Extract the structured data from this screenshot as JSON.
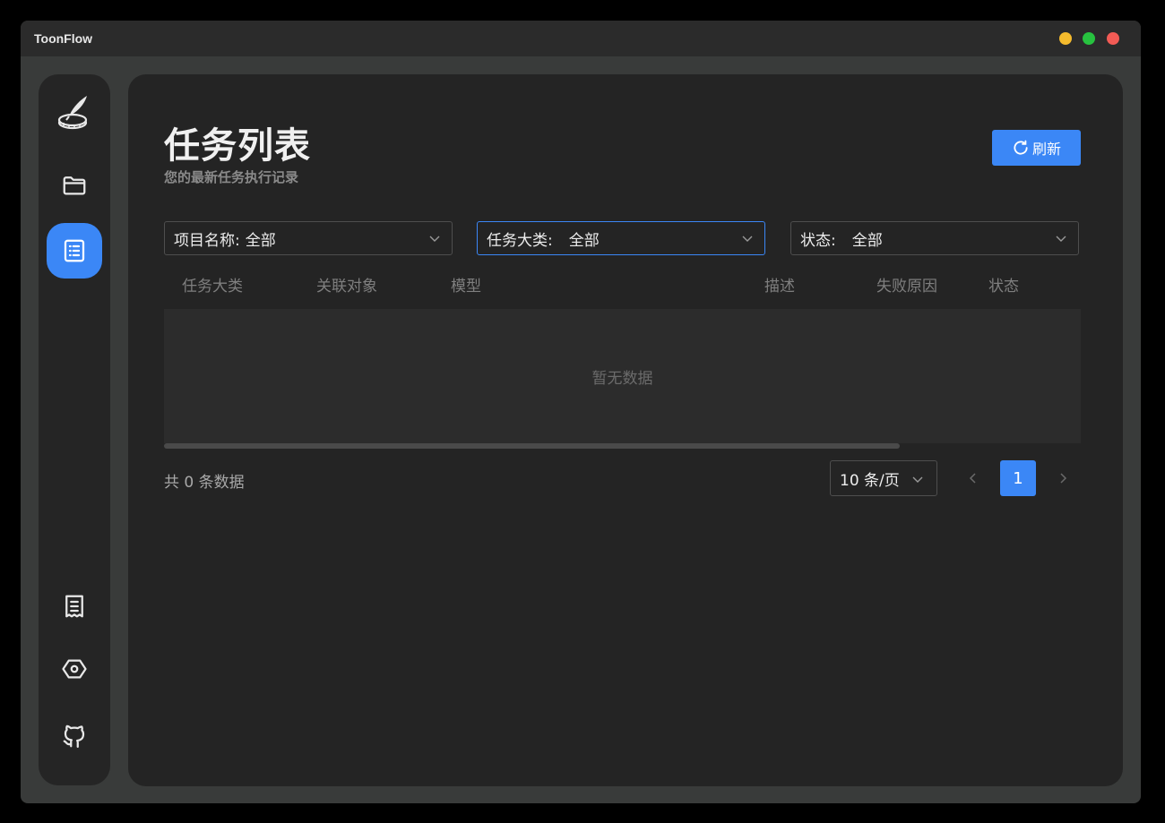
{
  "window": {
    "title": "ToonFlow"
  },
  "sidebar": {
    "items": [
      {
        "name": "pen-logo-icon",
        "active": false
      },
      {
        "name": "folder-icon",
        "active": false
      },
      {
        "name": "task-list-icon",
        "active": true
      },
      {
        "name": "receipt-icon",
        "active": false
      },
      {
        "name": "settings-hexagon-icon",
        "active": false
      },
      {
        "name": "github-icon",
        "active": false
      }
    ]
  },
  "header": {
    "title": "任务列表",
    "subtitle": "您的最新任务执行记录",
    "refresh_label": "刷新"
  },
  "filters": [
    {
      "label": "项目名称:",
      "value": "全部"
    },
    {
      "label": "任务大类:",
      "value": "全部"
    },
    {
      "label": "状态:",
      "value": "全部"
    }
  ],
  "table": {
    "columns": [
      "任务大类",
      "关联对象",
      "模型",
      "描述",
      "失败原因",
      "状态"
    ],
    "empty_text": "暂无数据"
  },
  "pagination": {
    "total_text": "共 0 条数据",
    "page_size": "10 条/页",
    "current_page": "1"
  },
  "colors": {
    "accent": "#3b87f6",
    "background": "#242424",
    "window_frame": "#393b3a",
    "minimize": "#f5bb2d",
    "maximize": "#27c23f",
    "close": "#f25b55"
  }
}
